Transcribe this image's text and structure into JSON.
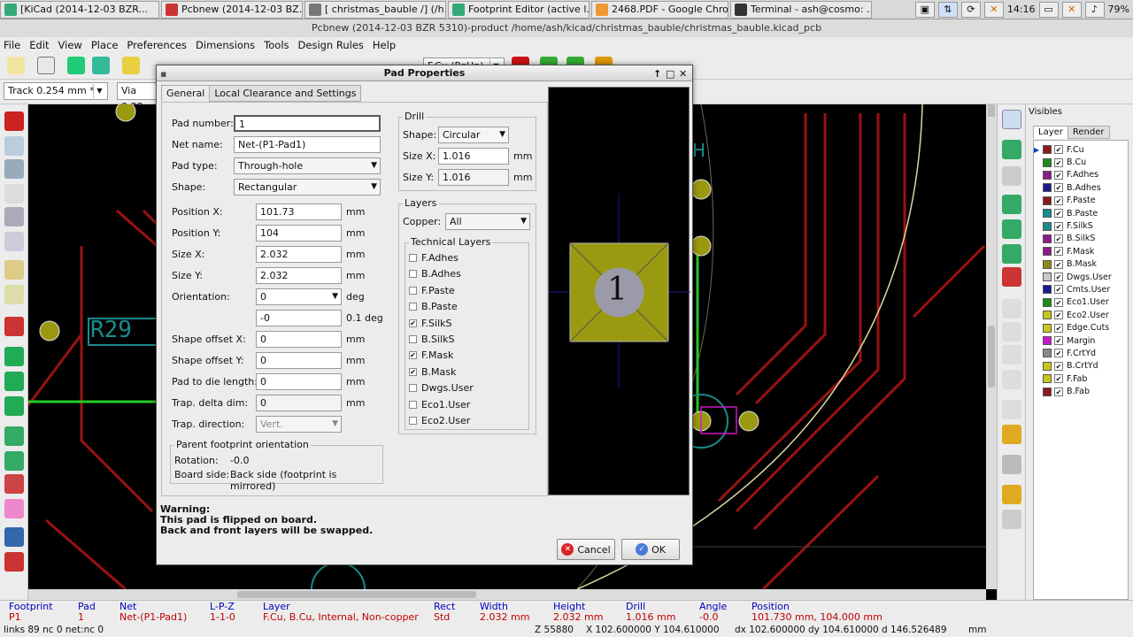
{
  "taskbar": {
    "tasks": [
      {
        "label": "[KiCad (2014-12-03 BZR...",
        "color": "#3a7"
      },
      {
        "label": "Pcbnew (2014-12-03 BZ...",
        "color": "#c33"
      },
      {
        "label": "[ christmas_bauble /] (/h...",
        "color": "#777"
      },
      {
        "label": "Footprint Editor (active l...",
        "color": "#3a7"
      },
      {
        "label": "2468.PDF - Google Chro...",
        "color": "#e93"
      },
      {
        "label": "Terminal - ash@cosmo: ...",
        "color": "#333"
      }
    ],
    "clock": "14:16",
    "battery": "79%"
  },
  "window": {
    "title": "Pcbnew (2014-12-03 BZR 5310)-product /home/ash/kicad/christmas_bauble/christmas_bauble.kicad_pcb"
  },
  "menu": [
    "File",
    "Edit",
    "View",
    "Place",
    "Preferences",
    "Dimensions",
    "Tools",
    "Design Rules",
    "Help"
  ],
  "toolbar": {
    "layer_combo": "F.Cu (PgUp)",
    "track_combo": "Track 0.254 mm *",
    "via_combo": "Via 0.88"
  },
  "canvas": {
    "ref_label": "R29",
    "h_label": "H"
  },
  "visibles": {
    "title": "Visibles",
    "tabs": [
      "Layer",
      "Render"
    ],
    "layers": [
      {
        "name": "F.Cu",
        "color": "#8b1a1a",
        "checked": true,
        "active": true
      },
      {
        "name": "B.Cu",
        "color": "#1a8b1a",
        "checked": true
      },
      {
        "name": "F.Adhes",
        "color": "#8b1a8b",
        "checked": true
      },
      {
        "name": "B.Adhes",
        "color": "#1a1a8b",
        "checked": true
      },
      {
        "name": "F.Paste",
        "color": "#8b1a1a",
        "checked": true
      },
      {
        "name": "B.Paste",
        "color": "#1a8b8b",
        "checked": true
      },
      {
        "name": "F.SilkS",
        "color": "#1a8b8b",
        "checked": true
      },
      {
        "name": "B.SilkS",
        "color": "#8b1a8b",
        "checked": true
      },
      {
        "name": "F.Mask",
        "color": "#8b1a8b",
        "checked": true
      },
      {
        "name": "B.Mask",
        "color": "#8b8b1a",
        "checked": true
      },
      {
        "name": "Dwgs.User",
        "color": "#c8c8c8",
        "checked": true
      },
      {
        "name": "Cmts.User",
        "color": "#1a1a8b",
        "checked": true
      },
      {
        "name": "Eco1.User",
        "color": "#1a8b1a",
        "checked": true
      },
      {
        "name": "Eco2.User",
        "color": "#c8c81a",
        "checked": true
      },
      {
        "name": "Edge.Cuts",
        "color": "#c8c81a",
        "checked": true
      },
      {
        "name": "Margin",
        "color": "#c81ac8",
        "checked": true
      },
      {
        "name": "F.CrtYd",
        "color": "#8b8b8b",
        "checked": true
      },
      {
        "name": "B.CrtYd",
        "color": "#c8c81a",
        "checked": true
      },
      {
        "name": "F.Fab",
        "color": "#c8c81a",
        "checked": true
      },
      {
        "name": "B.Fab",
        "color": "#8b1a1a",
        "checked": true
      }
    ]
  },
  "status": {
    "cols": [
      {
        "h": "Footprint",
        "v": "P1"
      },
      {
        "h": "Pad",
        "v": "1"
      },
      {
        "h": "Net",
        "v": "Net-(P1-Pad1)"
      },
      {
        "h": "L-P-Z",
        "v": "1-1-0"
      },
      {
        "h": "Layer",
        "v": "F.Cu, B.Cu, Internal, Non-copper"
      },
      {
        "h": "Rect",
        "v": "Std"
      },
      {
        "h": "Width",
        "v": "2.032 mm"
      },
      {
        "h": "Height",
        "v": "2.032 mm"
      },
      {
        "h": "Drill",
        "v": "1.016 mm"
      },
      {
        "h": "Angle",
        "v": "-0.0"
      },
      {
        "h": "Position",
        "v": "101.730 mm, 104.000 mm"
      }
    ],
    "links": "links 89 nc 0  net:nc 0",
    "zoom": "Z 55880",
    "xy": "X 102.600000  Y 104.610000",
    "dxy": "dx 102.600000  dy 104.610000  d 146.526489",
    "unit": "mm"
  },
  "dialog": {
    "title": "Pad Properties",
    "tabs": [
      "General",
      "Local Clearance and Settings"
    ],
    "pad_number_label": "Pad number:",
    "pad_number": "1",
    "net_name_label": "Net name:",
    "net_name": "Net-(P1-Pad1)",
    "pad_type_label": "Pad type:",
    "pad_type": "Through-hole",
    "shape_label": "Shape:",
    "shape": "Rectangular",
    "pos_x_label": "Position X:",
    "pos_x": "101.73",
    "pos_y_label": "Position Y:",
    "pos_y": "104",
    "size_x_label": "Size X:",
    "size_x": "2.032",
    "size_y_label": "Size Y:",
    "size_y": "2.032",
    "orientation_label": "Orientation:",
    "orientation": "0",
    "orientation_unit": "deg",
    "orientation_fine": "-0",
    "orientation_fine_unit": "0.1 deg",
    "offset_x_label": "Shape offset X:",
    "offset_x": "0",
    "offset_y_label": "Shape offset Y:",
    "offset_y": "0",
    "die_label": "Pad to die length:",
    "die": "0",
    "trap_delta_label": "Trap. delta dim:",
    "trap_delta": "0",
    "trap_dir_label": "Trap. direction:",
    "trap_dir": "Vert.",
    "unit_mm": "mm",
    "parent_group": "Parent footprint orientation",
    "rotation_label": "Rotation:",
    "rotation": "-0.0",
    "board_side_label": "Board side:",
    "board_side": "Back side (footprint is mirrored)",
    "drill_group": "Drill",
    "drill_shape_label": "Shape:",
    "drill_shape": "Circular",
    "drill_x_label": "Size X:",
    "drill_x": "1.016",
    "drill_y_label": "Size Y:",
    "drill_y": "1.016",
    "layers_group": "Layers",
    "copper_label": "Copper:",
    "copper": "All",
    "tech_group": "Technical Layers",
    "tech_layers": [
      {
        "name": "F.Adhes",
        "checked": false
      },
      {
        "name": "B.Adhes",
        "checked": false
      },
      {
        "name": "F.Paste",
        "checked": false
      },
      {
        "name": "B.Paste",
        "checked": false
      },
      {
        "name": "F.SilkS",
        "checked": true
      },
      {
        "name": "B.SilkS",
        "checked": false
      },
      {
        "name": "F.Mask",
        "checked": true
      },
      {
        "name": "B.Mask",
        "checked": true
      },
      {
        "name": "Dwgs.User",
        "checked": false
      },
      {
        "name": "Eco1.User",
        "checked": false
      },
      {
        "name": "Eco2.User",
        "checked": false
      }
    ],
    "preview_pad_number": "1",
    "warning_title": "Warning:",
    "warning_line1": "This pad is flipped on board.",
    "warning_line2": "Back and front layers will be swapped.",
    "cancel": "Cancel",
    "ok": "OK"
  },
  "colors": {
    "track_red": "#9b1212",
    "pad_yellow": "#9a9a10",
    "edge_cuts": "#d8d8a0"
  }
}
